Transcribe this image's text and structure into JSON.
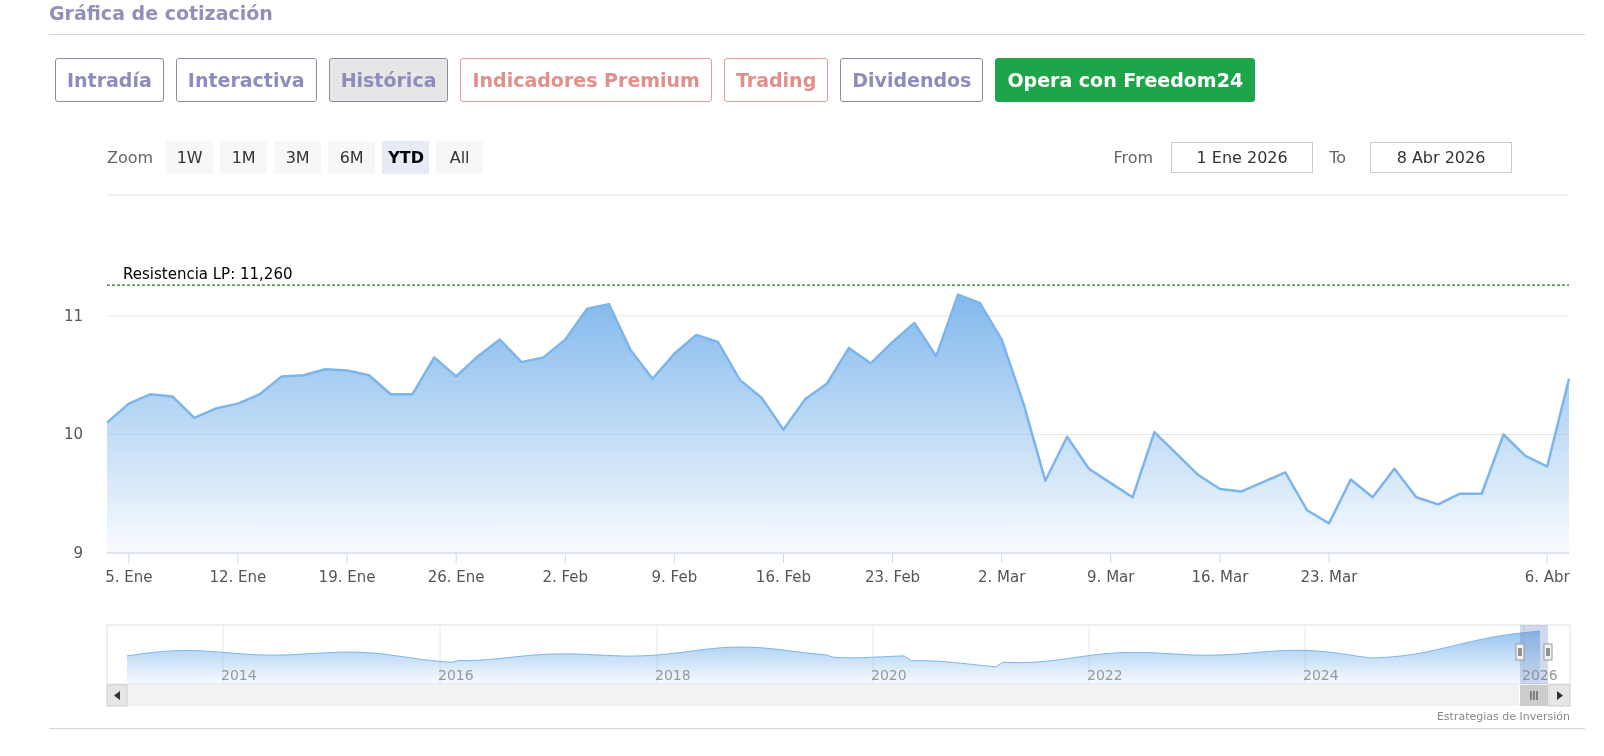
{
  "section_title": "Gráfica de cotización",
  "tabs": [
    {
      "label": "Intradía",
      "kind": "default",
      "selected": false
    },
    {
      "label": "Interactiva",
      "kind": "default",
      "selected": false
    },
    {
      "label": "Histórica",
      "kind": "default",
      "selected": true
    },
    {
      "label": "Indicadores Premium",
      "kind": "premium",
      "selected": false
    },
    {
      "label": "Trading",
      "kind": "premium",
      "selected": false
    },
    {
      "label": "Dividendos",
      "kind": "default",
      "selected": false
    },
    {
      "label": "Opera con Freedom24",
      "kind": "cta",
      "selected": false
    }
  ],
  "range_selector": {
    "label": "Zoom",
    "buttons": [
      {
        "label": "1W",
        "selected": false
      },
      {
        "label": "1M",
        "selected": false
      },
      {
        "label": "3M",
        "selected": false
      },
      {
        "label": "6M",
        "selected": false
      },
      {
        "label": "YTD",
        "selected": true
      },
      {
        "label": "All",
        "selected": false
      }
    ],
    "from_label": "From",
    "from_value": "1 Ene 2026",
    "to_label": "To",
    "to_value": "8 Abr 2026"
  },
  "chart": {
    "chart_data": {
      "type": "area",
      "categories": [
        null,
        "5. Ene",
        null,
        null,
        null,
        null,
        "12. Ene",
        null,
        null,
        null,
        null,
        "19. Ene",
        null,
        null,
        null,
        null,
        "26. Ene",
        null,
        null,
        null,
        null,
        "2. Feb",
        null,
        null,
        null,
        null,
        "9. Feb",
        null,
        null,
        null,
        null,
        "16. Feb",
        null,
        null,
        null,
        null,
        "23. Feb",
        null,
        null,
        null,
        null,
        "2. Mar",
        null,
        null,
        null,
        null,
        "9. Mar",
        null,
        null,
        null,
        null,
        "16. Mar",
        null,
        null,
        null,
        null,
        "23. Mar",
        null,
        null,
        null,
        null,
        null,
        null,
        null,
        null,
        null,
        "6. Abr",
        null
      ],
      "ylim": [
        9,
        12.02
      ],
      "yticks": [
        9,
        10,
        11
      ],
      "series": [
        {
          "color": "#7cb5ec",
          "values": [
            10.1,
            10.26,
            10.34,
            10.32,
            10.14,
            10.22,
            10.26,
            10.34,
            10.49,
            10.5,
            10.55,
            10.54,
            10.5,
            10.34,
            10.34,
            10.65,
            10.49,
            10.66,
            10.8,
            10.61,
            10.65,
            10.8,
            11.06,
            11.1,
            10.71,
            10.47,
            10.68,
            10.84,
            10.78,
            10.46,
            10.31,
            10.04,
            10.3,
            10.43,
            10.73,
            10.6,
            10.78,
            10.94,
            10.66,
            11.18,
            11.11,
            10.8,
            10.26,
            9.61,
            9.98,
            9.71,
            9.59,
            9.47,
            10.02,
            9.84,
            9.66,
            9.54,
            9.52,
            9.6,
            9.68,
            9.36,
            9.25,
            9.62,
            9.47,
            9.71,
            9.47,
            9.41,
            9.5,
            9.5,
            10.0,
            9.82,
            9.73,
            10.47
          ]
        }
      ],
      "ref_lines": [
        {
          "axis": "y",
          "value": 11.26,
          "color": "#1e7a1e",
          "label": "Resistencia LP: 11,260"
        }
      ]
    },
    "navigator": {
      "year_labels": [
        "2014",
        "2016",
        "2018",
        "2020",
        "2022",
        "2024",
        "2026"
      ]
    },
    "credits": "Estrategias de Inversión"
  }
}
